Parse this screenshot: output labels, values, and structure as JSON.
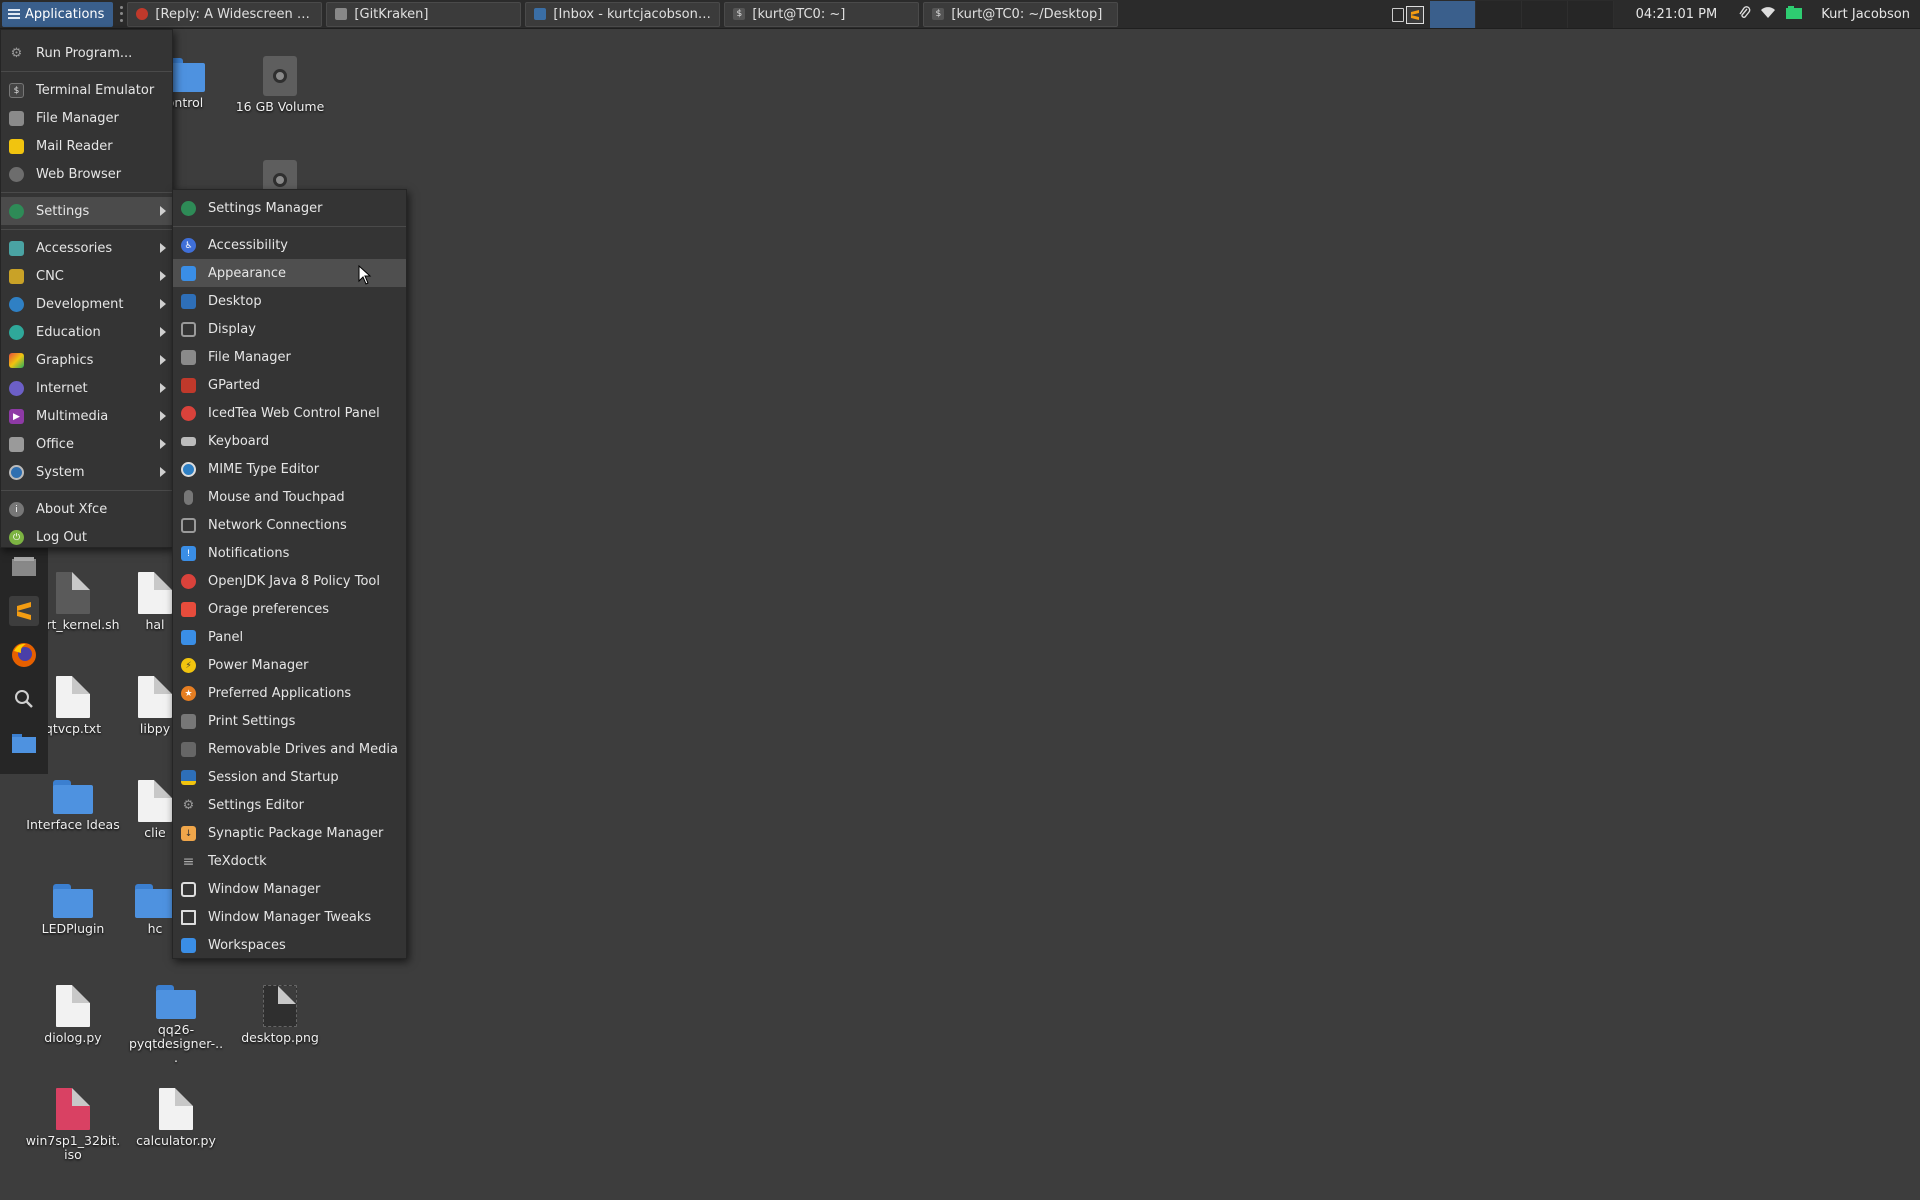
{
  "panel": {
    "apps_label": "Applications",
    "tasks": [
      {
        "label": "[Reply: A Widescreen Blen...",
        "icon": "thunderbird-icon",
        "color": "#c0392b"
      },
      {
        "label": "[GitKraken]",
        "icon": "gitkraken-icon",
        "color": "#777777"
      },
      {
        "label": "[Inbox - kurtcjacobson@g...",
        "icon": "mail-icon",
        "color": "#3a6ea5"
      },
      {
        "label": "[kurt@TC0: ~]",
        "icon": "terminal-icon",
        "color": "#555555"
      },
      {
        "label": "[kurt@TC0: ~/Desktop]",
        "icon": "terminal-icon",
        "color": "#555555"
      }
    ],
    "clock": "04:21:01 PM",
    "user": "Kurt Jacobson"
  },
  "main_menu": {
    "run": "Run Program...",
    "favorites": [
      "Terminal Emulator",
      "File Manager",
      "Mail Reader",
      "Web Browser"
    ],
    "settings": "Settings",
    "categories": [
      "Accessories",
      "CNC",
      "Development",
      "Education",
      "Graphics",
      "Internet",
      "Multimedia",
      "Office",
      "System"
    ],
    "about": "About Xfce",
    "logout": "Log Out"
  },
  "settings_menu": {
    "manager": "Settings Manager",
    "items": [
      "Accessibility",
      "Appearance",
      "Desktop",
      "Display",
      "File Manager",
      "GParted",
      "IcedTea Web Control Panel",
      "Keyboard",
      "MIME Type Editor",
      "Mouse and Touchpad",
      "Network Connections",
      "Notifications",
      "OpenJDK Java 8 Policy Tool",
      "Orage preferences",
      "Panel",
      "Power Manager",
      "Preferred Applications",
      "Print Settings",
      "Removable Drives and Media",
      "Session and Startup",
      "Settings Editor",
      "Synaptic Package Manager",
      "TeXdoctk",
      "Window Manager",
      "Window Manager Tweaks",
      "Workspaces"
    ]
  },
  "desktop": {
    "icons": [
      {
        "label": "ontrol"
      },
      {
        "label": "16 GB Volume"
      },
      {
        "label": "5.8rt_kernel.sh"
      },
      {
        "label": "hal"
      },
      {
        "label": "qtvcp.txt"
      },
      {
        "label": "libpy"
      },
      {
        "label": "Interface Ideas"
      },
      {
        "label": "clie"
      },
      {
        "label": "LEDPlugin"
      },
      {
        "label": "hc"
      },
      {
        "label": "diolog.py"
      },
      {
        "label": "qq26-pyqtdesigner-..."
      },
      {
        "label": "desktop.png"
      },
      {
        "label": "win7sp1_32bit.iso"
      },
      {
        "label": "calculator.py"
      }
    ]
  }
}
